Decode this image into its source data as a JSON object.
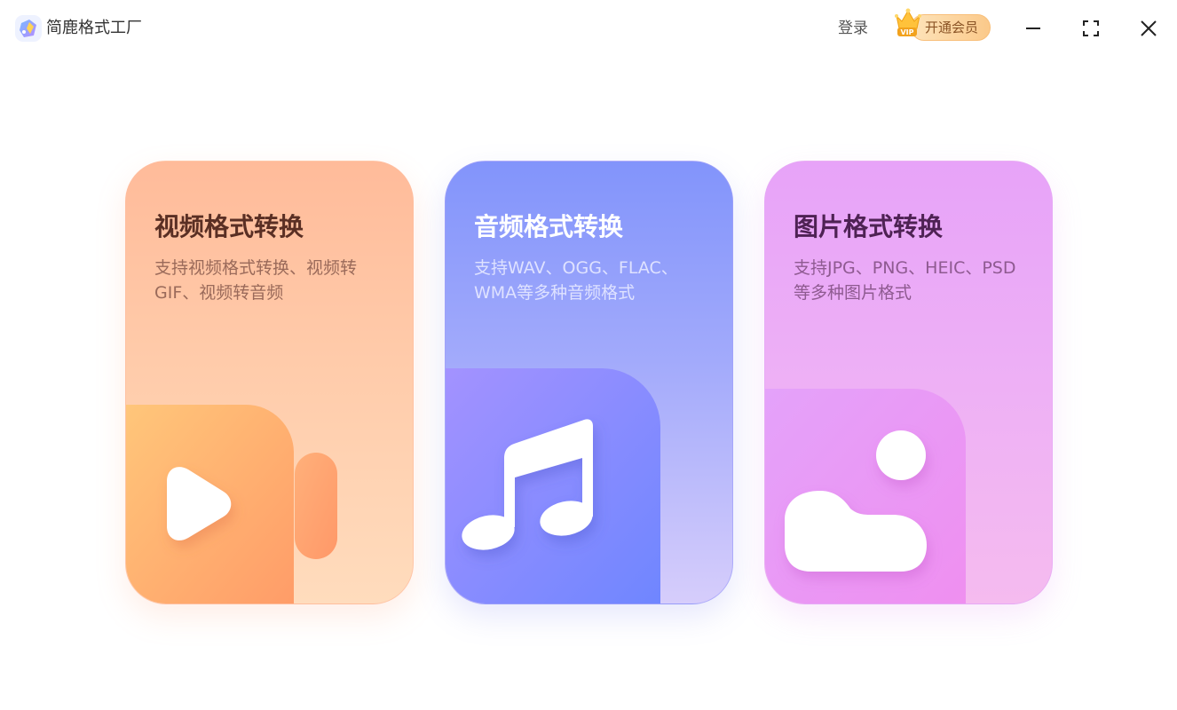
{
  "app": {
    "title": "简鹿格式工厂",
    "logo_icon": "app-logo-icon"
  },
  "header": {
    "login_label": "登录",
    "vip_label": "开通会员",
    "vip_badge_text": "VIP",
    "minimize_icon": "minimize-icon",
    "maximize_icon": "maximize-icon",
    "close_icon": "close-icon"
  },
  "cards": [
    {
      "title": "视频格式转换",
      "description": "支持视频格式转换、视频转GIF、视频转音频",
      "icon": "video-camera-icon",
      "accent": "#ffbb9a"
    },
    {
      "title": "音频格式转换",
      "description": "支持WAV、OGG、FLAC、WMA等多种音频格式",
      "icon": "music-note-icon",
      "accent": "#8294fb"
    },
    {
      "title": "图片格式转换",
      "description": "支持JPG、PNG、HEIC、PSD等多种图片格式",
      "icon": "image-cloud-icon",
      "accent": "#e7a3f8"
    }
  ]
}
